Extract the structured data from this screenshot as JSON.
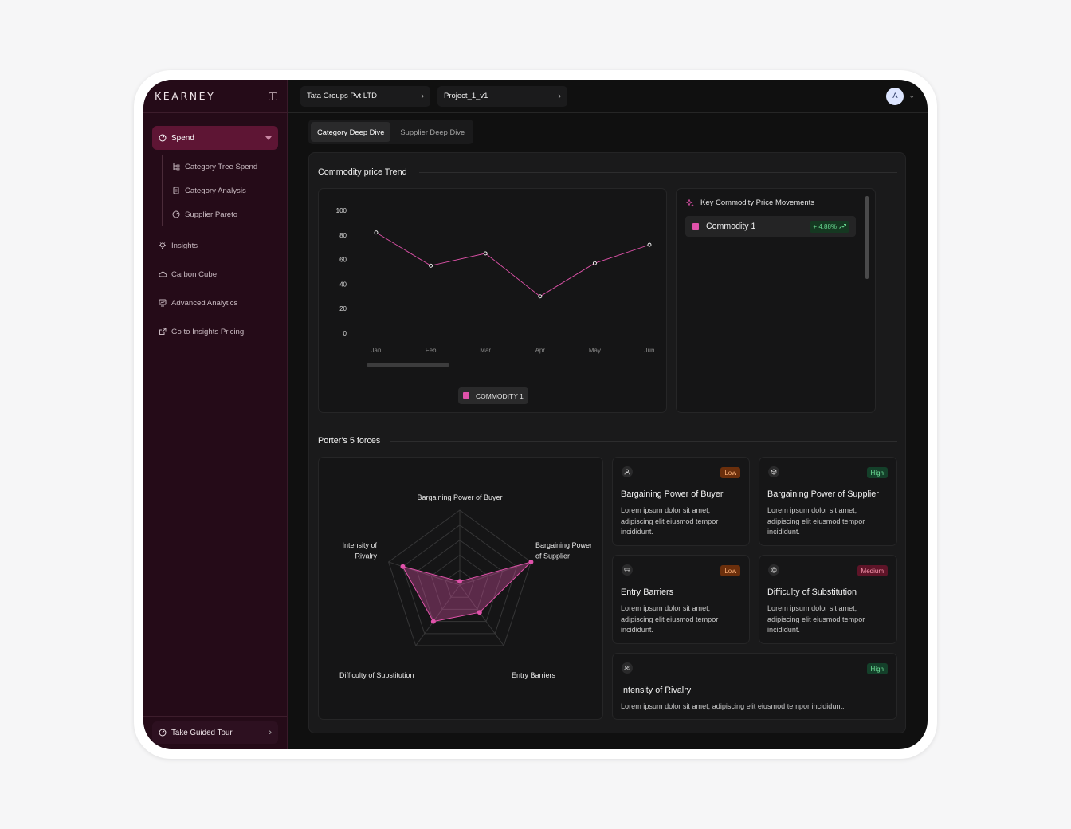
{
  "sidebar": {
    "brand": "KEARNEY",
    "active_item": "Spend",
    "sub_items": [
      "Category Tree Spend",
      "Category Analysis",
      "Supplier Pareto"
    ],
    "items": [
      "Insights",
      "Carbon Cube",
      "Advanced Analytics",
      "Go to Insights Pricing"
    ],
    "tour_label": "Take Guided Tour"
  },
  "topbar": {
    "breadcrumb_company": "Tata Groups Pvt LTD",
    "breadcrumb_project": "Project_1_v1",
    "avatar_initial": "A"
  },
  "tabs": [
    "Category Deep Dive",
    "Supplier Deep Dive"
  ],
  "commodity": {
    "section_title": "Commodity price Trend",
    "legend": "COMMODITY 1",
    "side_title": "Key Commodity Price Movements",
    "item_name": "Commodity 1",
    "item_change": "+ 4.88%",
    "color": "#e052aa"
  },
  "chart_data": {
    "type": "line",
    "x": [
      "Jan",
      "Feb",
      "Mar",
      "Apr",
      "May",
      "Jun"
    ],
    "series": [
      {
        "name": "COMMODITY 1",
        "values": [
          82,
          55,
          65,
          30,
          57,
          72
        ]
      }
    ],
    "ylim": [
      0,
      100
    ],
    "yticks": [
      0,
      20,
      40,
      60,
      80,
      100
    ],
    "title": "",
    "xlabel": "",
    "ylabel": "",
    "legend": "bottom",
    "grid": false
  },
  "porter": {
    "section_title": "Porter's 5 forces",
    "axes": [
      "Bargaining Power of Buyer",
      "Bargaining Power of Supplier",
      "Entry Barriers",
      "Difficulty of Substitution",
      "Intensity of Rivalry"
    ],
    "values": [
      0.05,
      1.0,
      0.45,
      0.6,
      0.8
    ],
    "cards": [
      {
        "title": "Bargaining Power of Buyer",
        "level": "Low",
        "desc": "Lorem ipsum dolor sit amet, adipiscing elit eiusmod tempor incididunt.",
        "icon": "user-icon"
      },
      {
        "title": "Bargaining Power of Supplier",
        "level": "High",
        "desc": "Lorem ipsum dolor sit amet, adipiscing elit eiusmod tempor incididunt.",
        "icon": "box-icon"
      },
      {
        "title": "Entry Barriers",
        "level": "Low",
        "desc": "Lorem ipsum dolor sit amet, adipiscing elit eiusmod tempor incididunt.",
        "icon": "barrier-icon"
      },
      {
        "title": "Difficulty of Substitution",
        "level": "Medium",
        "desc": "Lorem ipsum dolor sit amet, adipiscing elit eiusmod tempor incididunt.",
        "icon": "target-icon"
      },
      {
        "title": "Intensity of Rivalry",
        "level": "High",
        "desc": "Lorem ipsum dolor sit amet, adipiscing elit eiusmod tempor incididunt.",
        "icon": "users-icon"
      }
    ],
    "level_colors": {
      "Low": {
        "bg": "#6b2f0c",
        "fg": "#ffb37a"
      },
      "High": {
        "bg": "#14402a",
        "fg": "#70e29a"
      },
      "Medium": {
        "bg": "#5e1428",
        "fg": "#ff9db4"
      }
    }
  }
}
